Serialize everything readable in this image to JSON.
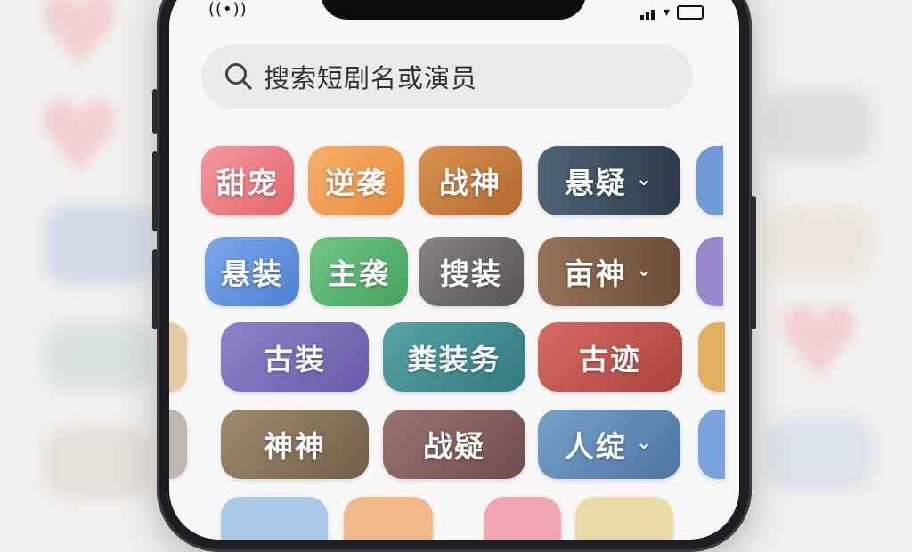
{
  "search": {
    "placeholder": "搜索短剧名或演员"
  },
  "colors": {
    "pink": "#ec7479",
    "orange": "#ef9a4c",
    "brown_orange": "#c5773a",
    "slate": "#3d4d5d",
    "blue": "#5d8fde",
    "green": "#55b36c",
    "gray": "#6c6868",
    "brown": "#7c5d48",
    "purple": "#7a6cb8",
    "teal": "#3f8d92",
    "red": "#c5554f",
    "olive": "#8e7a5d",
    "mauve": "#86605f",
    "sky": "#5d84b0"
  },
  "tags": {
    "row1": [
      {
        "label": "甜宠",
        "dropdown": false
      },
      {
        "label": "逆袭",
        "dropdown": false
      },
      {
        "label": "战神",
        "dropdown": false
      },
      {
        "label": "悬疑",
        "dropdown": true
      }
    ],
    "row2": [
      {
        "label": "悬装",
        "dropdown": false
      },
      {
        "label": "主袭",
        "dropdown": false
      },
      {
        "label": "搜装",
        "dropdown": false
      },
      {
        "label": "亩神",
        "dropdown": true
      }
    ],
    "row3": [
      {
        "label": "古装",
        "dropdown": false
      },
      {
        "label": "粪装务",
        "dropdown": false
      },
      {
        "label": "古迹",
        "dropdown": false
      }
    ],
    "row4": [
      {
        "label": "神神",
        "dropdown": false
      },
      {
        "label": "战疑",
        "dropdown": false
      },
      {
        "label": "人绽",
        "dropdown": true
      }
    ]
  }
}
